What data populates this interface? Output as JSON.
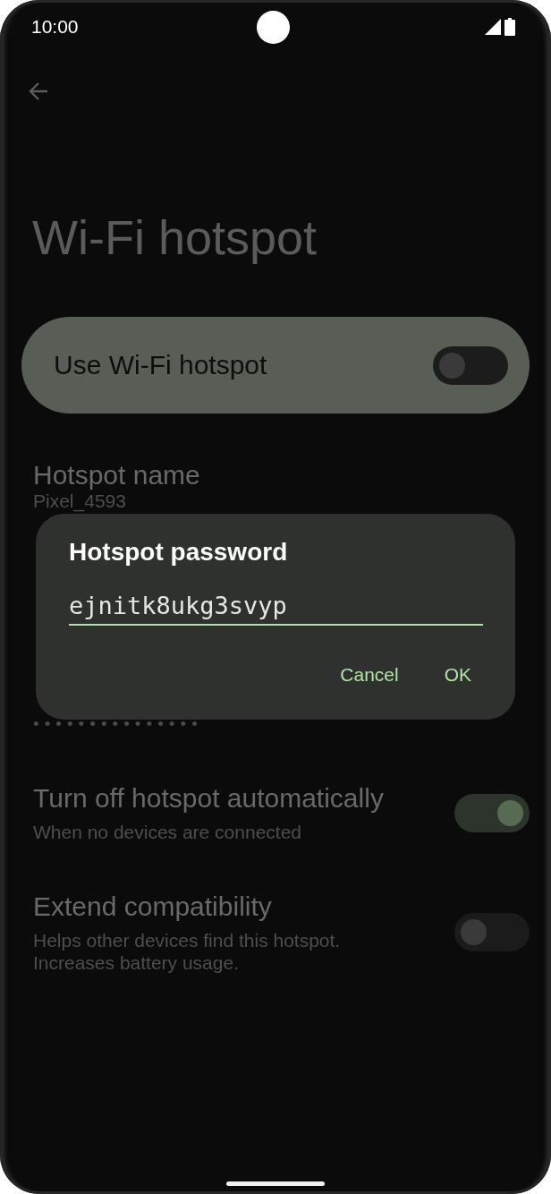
{
  "status_bar": {
    "time": "10:00"
  },
  "page": {
    "title": "Wi-Fi hotspot"
  },
  "main_switch": {
    "label": "Use Wi-Fi hotspot",
    "on": false
  },
  "settings": [
    {
      "kind": "text",
      "title": "Hotspot name",
      "summary": "Pixel_4593"
    },
    {
      "kind": "masked",
      "summary": "•••••••••••••••"
    },
    {
      "kind": "switch",
      "title": "Turn off hotspot automatically",
      "summary": "When no devices are connected",
      "on": true
    },
    {
      "kind": "switch",
      "title": "Extend compatibility",
      "summary": "Helps other devices find this hotspot. Increases battery usage.",
      "on": false
    }
  ],
  "dialog": {
    "title": "Hotspot password",
    "value": "ejnitk8ukg3svyp",
    "focused": true,
    "buttons": [
      "Cancel",
      "OK"
    ]
  }
}
